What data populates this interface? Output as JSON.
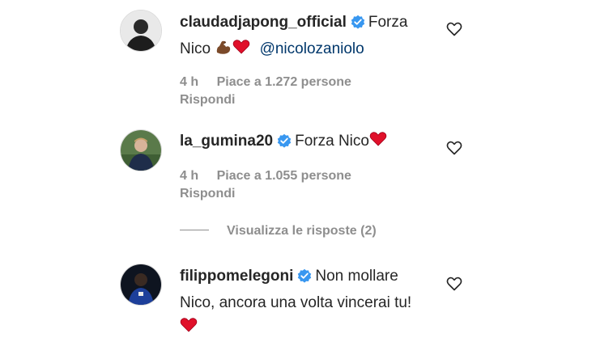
{
  "comments": [
    {
      "username": "claudadjapong_official",
      "line1_text": "Forza",
      "line2_text": "Nico",
      "emojis": "flexed-biceps-icon, red-heart-icon",
      "mention": "@nicolozaniolo",
      "time": "4 h",
      "likes": "Piace a 1.272 persone",
      "reply_label": "Rispondi"
    },
    {
      "username": "la_gumina20",
      "line1_text": "Forza Nico",
      "emojis": "red-heart-icon",
      "time": "4 h",
      "likes": "Piace a 1.055 persone",
      "reply_label": "Rispondi"
    },
    {
      "username": "filippomelegoni",
      "line1_text": "Non mollare",
      "line2_text": "Nico, ancora una volta vincerai tu!",
      "emojis": "red-heart-icon"
    }
  ],
  "view_replies_label": "Visualizza le risposte (2)",
  "colors": {
    "text": "#262626",
    "secondary": "#8e8e8e",
    "mention": "#00376b",
    "verified": "#3897f0",
    "heart_emoji": "#e0102a"
  }
}
